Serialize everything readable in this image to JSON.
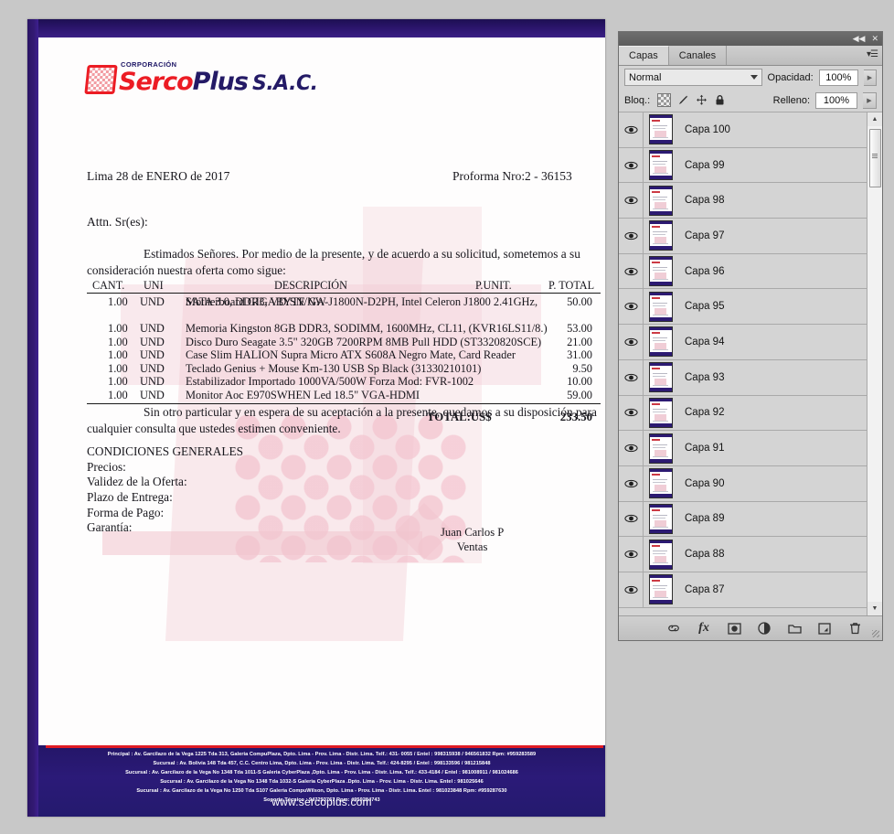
{
  "document": {
    "logo": {
      "corporacion": "CORPORACIÓN",
      "serco": "Serco",
      "plus": "Plus",
      "sac": "S.A.C."
    },
    "date": "Lima 28 de ENERO de 2017",
    "proforma_label": "Proforma Nro:",
    "proforma_number": "2 - 36153",
    "attn": "Attn. Sr(es):",
    "intro": "Estimados Señores. Por medio de la presente, y de acuerdo a su solicitud, sometemos a su consideración nuestra oferta como sigue:",
    "table": {
      "headers": {
        "cant": "CANT.",
        "uni": "UNI",
        "desc": "DESCRIPCIÓN",
        "punit": "P.UNIT.",
        "ptotal": "P. TOTAL"
      },
      "rows": [
        {
          "cant": "1.00",
          "uni": "UND",
          "desc": "Motherboard GIGABYTE GA-J1800N-D2PH, Intel Celeron J1800 2.41GHz,",
          "desc2": "SATA 3.0, DDR3, VD/SN/NW",
          "punit": "",
          "ptotal": "50.00"
        },
        {
          "cant": "1.00",
          "uni": "UND",
          "desc": "Memoria Kingston 8GB DDR3, SODIMM, 1600MHz, CL11, (KVR16LS11/8.)",
          "punit": "",
          "ptotal": "53.00"
        },
        {
          "cant": "1.00",
          "uni": "UND",
          "desc": "Disco Duro Seagate 3.5\" 320GB 7200RPM 8MB Pull HDD (ST3320820SCE)",
          "punit": "",
          "ptotal": "21.00"
        },
        {
          "cant": "1.00",
          "uni": "UND",
          "desc": "Case Slim HALION Supra Micro ATX S608A Negro Mate, Card Reader",
          "punit": "",
          "ptotal": "31.00"
        },
        {
          "cant": "1.00",
          "uni": "UND",
          "desc": "Teclado Genius + Mouse Km-130 USB Sp Black (31330210101)",
          "punit": "",
          "ptotal": "9.50"
        },
        {
          "cant": "1.00",
          "uni": "UND",
          "desc": "Estabilizador Importado 1000VA/500W Forza Mod: FVR-1002",
          "punit": "",
          "ptotal": "10.00"
        },
        {
          "cant": "1.00",
          "uni": "UND",
          "desc": "Monitor Aoc E970SWHEN Led 18.5\"  VGA-HDMI",
          "punit": "",
          "ptotal": "59.00"
        }
      ],
      "total_label": "TOTAL:US$",
      "total_value": "233.50"
    },
    "closing": "Sin otro particular y en espera de su aceptación a la presente, quedamos a su disposición para cualquier consulta que ustedes estimen conveniente.",
    "conditions": {
      "title": "CONDICIONES GENERALES",
      "items": [
        "Precios:",
        "Validez de la Oferta:",
        "Plazo de Entrega:",
        "Forma de Pago:",
        "Garantía:"
      ]
    },
    "signature": {
      "name": "Juan Carlos P",
      "role": "Ventas"
    },
    "footer": {
      "lines": [
        "Principal : Av. Garcilazo de la Vega 1225  Tda 313, Galeria CompuPlaza, Dpto. Lima - Prov. Lima - Distr. Lima. Telf.: 431- 0055 / Entel : 998315938  /  946561832  Rpm: #959283589",
        "Sucursal : Av. Bolivia 148 Tda 457, C.C. Centro Lima, Dpto. Lima - Prov. Lima - Distr. Lima. Telf.: 424-8295 / Entel : 998133596  /  981215848",
        "Sucursal : Av. Garcilazo de la Vega No 1348 Tda 1011-S Galeria CyberPlaza ,Dpto. Lima - Prov. Lima - Distr. Lima. Telf.: 433-4184 / Entel : 981008911  /  981024686",
        "Sucursal : Av. Garcilazo de la Vega No 1348 Tda 1032-S Galeria CyberPlaza .Dpto. Lima - Prov. Lima - Distr. Lima. Entel : 981025646",
        "Sucursal : Av. Garcilazo de la Vega No 1250 Tda S107 Galeria CompuWilson, Dpto. Lima - Prov. Lima - Distr. Lima. Entel : 981023848  Rpm: #959287630",
        "Soporte Técnico : 947293767  Rpm: #959284743"
      ],
      "website": "www.sercoplus.com"
    }
  },
  "layers_panel": {
    "titlebar": {
      "collapse_icon": "collapse-icon",
      "close_icon": "close-icon"
    },
    "tabs": [
      {
        "label": "Capas",
        "active": true
      },
      {
        "label": "Canales",
        "active": false
      }
    ],
    "menu_icon": "panel-menu-icon",
    "blend_mode": "Normal",
    "opacity_label": "Opacidad:",
    "opacity_value": "100%",
    "lock_label": "Bloq.:",
    "lock_icons": [
      "lock-transparency-icon",
      "lock-paint-icon",
      "lock-move-icon",
      "lock-all-icon"
    ],
    "fill_label": "Relleno:",
    "fill_value": "100%",
    "layers": [
      {
        "name": "Capa 100",
        "visible": true
      },
      {
        "name": "Capa 99",
        "visible": true
      },
      {
        "name": "Capa 98",
        "visible": true
      },
      {
        "name": "Capa 97",
        "visible": true
      },
      {
        "name": "Capa 96",
        "visible": true
      },
      {
        "name": "Capa 95",
        "visible": true
      },
      {
        "name": "Capa 94",
        "visible": true
      },
      {
        "name": "Capa 93",
        "visible": true
      },
      {
        "name": "Capa 92",
        "visible": true
      },
      {
        "name": "Capa 91",
        "visible": true
      },
      {
        "name": "Capa 90",
        "visible": true
      },
      {
        "name": "Capa 89",
        "visible": true
      },
      {
        "name": "Capa 88",
        "visible": true
      },
      {
        "name": "Capa 87",
        "visible": true
      }
    ],
    "bottom_icons": [
      "link-layers-icon",
      "layer-style-fx-icon",
      "add-layer-mask-icon",
      "adjustment-layer-icon",
      "new-group-icon",
      "new-layer-icon",
      "delete-layer-icon"
    ]
  },
  "colors": {
    "background": "#c8c8c8",
    "doc_border": "#2a1464",
    "logo_red": "#ec1c24",
    "logo_navy": "#241a66",
    "footer_navy": "#2b1a78",
    "footer_red": "#e01b24",
    "panel_bg": "#d4d4d4"
  }
}
